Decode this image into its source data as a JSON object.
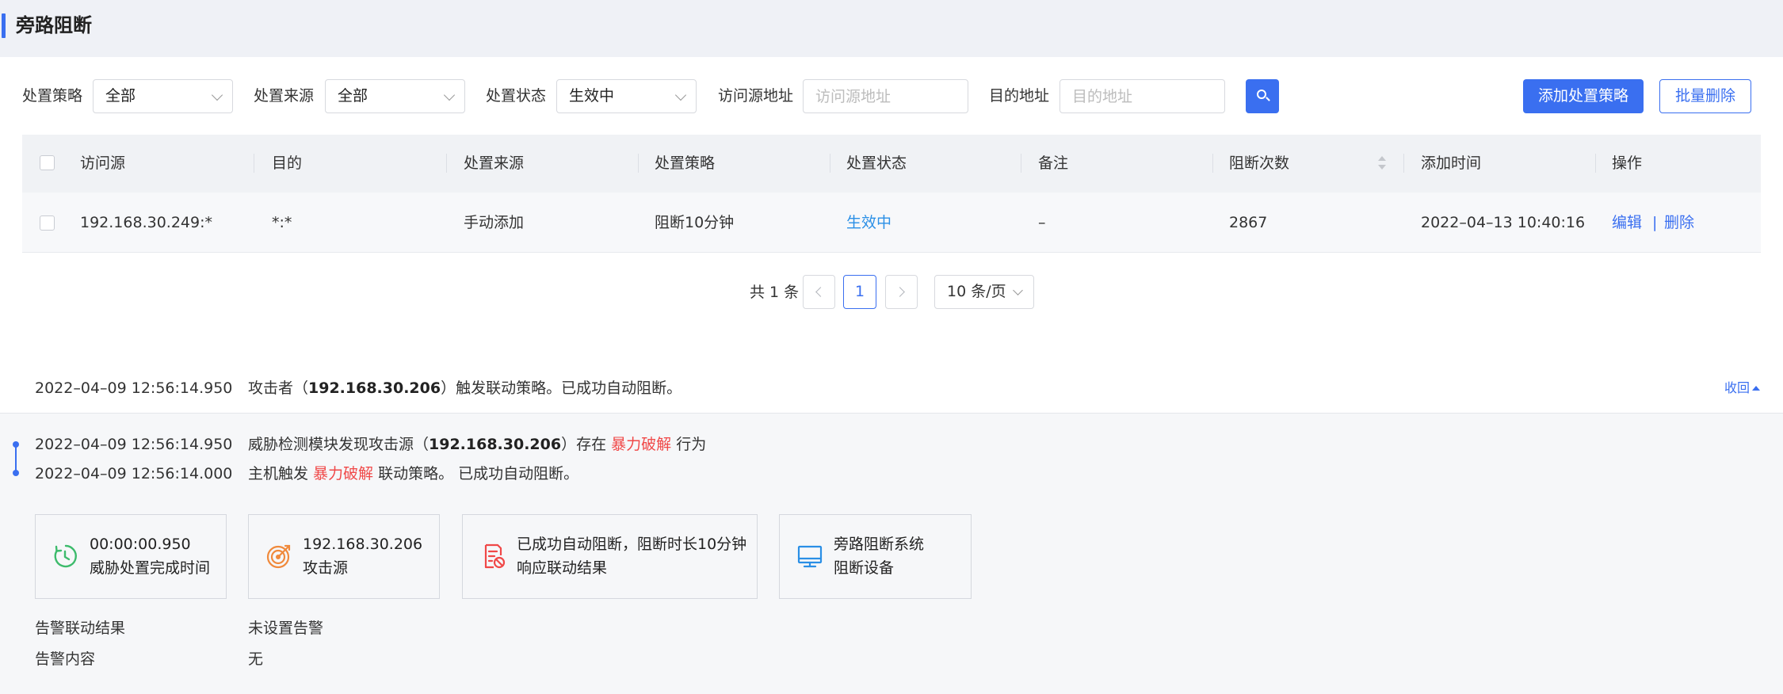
{
  "header": {
    "title": "旁路阻断"
  },
  "filters": {
    "strategy_label": "处置策略",
    "strategy_value": "全部",
    "source_label": "处置来源",
    "source_value": "全部",
    "status_label": "处置状态",
    "status_value": "生效中",
    "visit_label": "访问源地址",
    "visit_placeholder": "访问源地址",
    "dest_label": "目的地址",
    "dest_placeholder": "目的地址",
    "add_button": "添加处置策略",
    "batch_delete_button": "批量删除"
  },
  "table": {
    "columns": [
      "访问源",
      "目的",
      "处置来源",
      "处置策略",
      "处置状态",
      "备注",
      "阻断次数",
      "添加时间",
      "操作"
    ],
    "rows": [
      {
        "source": "192.168.30.249:*",
        "dest": "*:*",
        "origin": "手动添加",
        "strategy": "阻断10分钟",
        "status": "生效中",
        "remark": "–",
        "count": "2867",
        "time": "2022–04–13 10:40:16",
        "edit": "编辑",
        "sep": "|",
        "delete": "删除"
      }
    ]
  },
  "pagination": {
    "total": "共 1 条",
    "current": "1",
    "page_size": "10 条/页"
  },
  "event": {
    "time": "2022–04–09 12:56:14.950",
    "prefix": "攻击者（",
    "ip": "192.168.30.206",
    "suffix": "）触发联动策略。已成功自动阻断。",
    "collapse": "收回"
  },
  "timeline": [
    {
      "time": "2022–04–09 12:56:14.950",
      "pre": "威胁检测模块发现攻击源（",
      "ip": "192.168.30.206",
      "mid": "）存在 ",
      "tag": "暴力破解",
      "post": " 行为"
    },
    {
      "time": "2022–04–09 12:56:14.000",
      "pre": "主机触发 ",
      "tag": "暴力破解",
      "post": " 联动策略。 已成功自动阻断。"
    }
  ],
  "cards": [
    {
      "icon": "timer-icon",
      "line1": "00:00:00.950",
      "line2": "威胁处置完成时间",
      "color": "#3dbb6c"
    },
    {
      "icon": "target-icon",
      "line1": "192.168.30.206",
      "line2": "攻击源",
      "color": "#f08a3c"
    },
    {
      "icon": "report-icon",
      "line1": "已成功自动阻断，阻断时长10分钟",
      "line2": "响应联动结果",
      "color": "#f04848"
    },
    {
      "icon": "monitor-icon",
      "line1": "旁路阻断系统",
      "line2": "阻断设备",
      "color": "#2a8fe6"
    }
  ],
  "alarm": {
    "result_label": "告警联动结果",
    "result_value": "未设置告警",
    "content_label": "告警内容",
    "content_value": "无"
  },
  "colors": {
    "accent": "#3a6ff0",
    "danger": "#f04848",
    "active": "#2a8fe6"
  }
}
